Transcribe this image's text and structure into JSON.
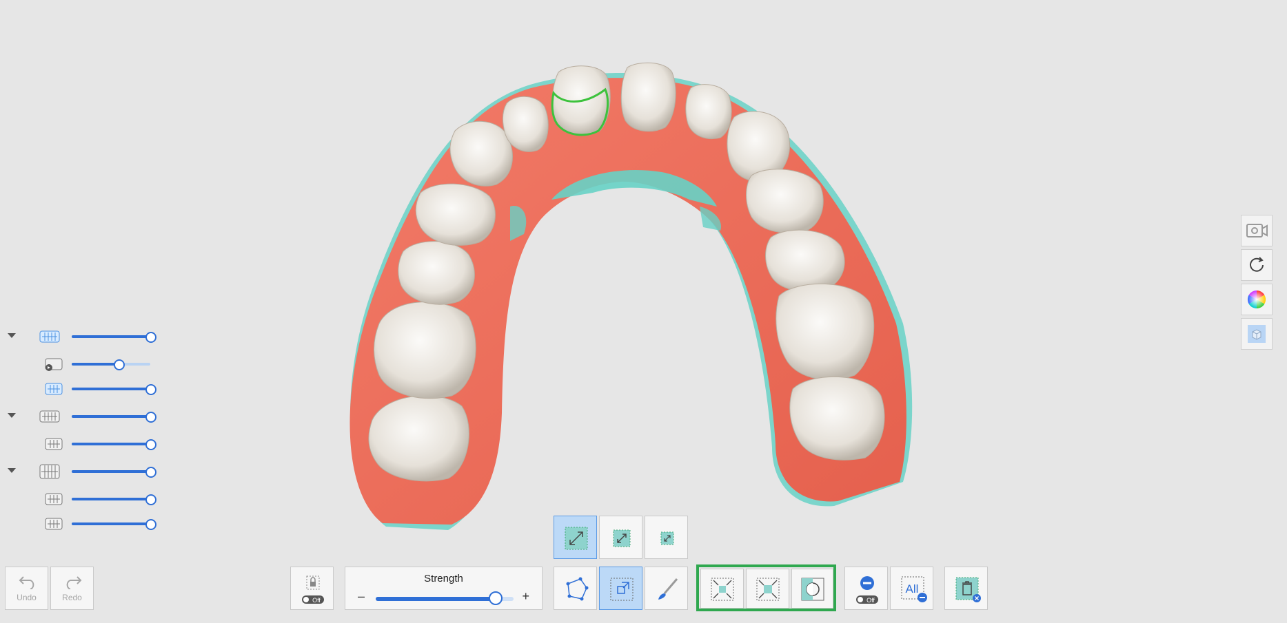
{
  "layers": [
    {
      "name": "upper-jaw-group",
      "collapsible": true,
      "value": 1.0
    },
    {
      "name": "upper-jaw-scan",
      "collapsible": false,
      "value": 0.6
    },
    {
      "name": "upper-jaw-sub",
      "collapsible": false,
      "value": 1.0
    },
    {
      "name": "lower-jaw-group",
      "collapsible": true,
      "value": 1.0
    },
    {
      "name": "lower-jaw-scan",
      "collapsible": false,
      "value": 1.0
    },
    {
      "name": "occlusion-group",
      "collapsible": true,
      "value": 1.0
    },
    {
      "name": "occlusion-a",
      "collapsible": false,
      "value": 1.0
    },
    {
      "name": "occlusion-b",
      "collapsible": false,
      "value": 1.0
    }
  ],
  "history": {
    "undo_label": "Undo",
    "redo_label": "Redo"
  },
  "lock": {
    "state_label": "Off"
  },
  "strength": {
    "label": "Strength",
    "minus": "–",
    "plus": "+",
    "value": 0.87
  },
  "filter": {
    "state_label": "Off",
    "all_label": "All"
  },
  "colors": {
    "gum": "#ef6e5b",
    "tooth": "#ece8e2",
    "accent": "#2f6fd6",
    "selection_green": "#2fa84f",
    "highlight_teal": "#67d1c5"
  }
}
